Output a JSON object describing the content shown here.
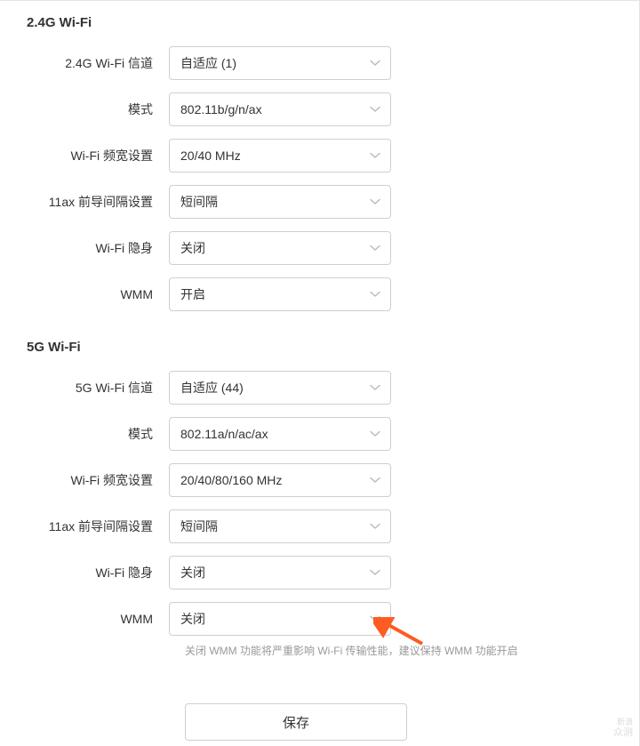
{
  "section24": {
    "title": "2.4G Wi-Fi",
    "channel": {
      "label": "2.4G Wi-Fi 信道",
      "value": "自适应 (1)"
    },
    "mode": {
      "label": "模式",
      "value": "802.11b/g/n/ax"
    },
    "bandwidth": {
      "label": "Wi-Fi 频宽设置",
      "value": "20/40 MHz"
    },
    "guard": {
      "label": "11ax 前导间隔设置",
      "value": "短间隔"
    },
    "hidden": {
      "label": "Wi-Fi 隐身",
      "value": "关闭"
    },
    "wmm": {
      "label": "WMM",
      "value": "开启"
    }
  },
  "section5": {
    "title": "5G Wi-Fi",
    "channel": {
      "label": "5G Wi-Fi 信道",
      "value": "自适应 (44)"
    },
    "mode": {
      "label": "模式",
      "value": "802.11a/n/ac/ax"
    },
    "bandwidth": {
      "label": "Wi-Fi 频宽设置",
      "value": "20/40/80/160 MHz"
    },
    "guard": {
      "label": "11ax 前导间隔设置",
      "value": "短间隔"
    },
    "hidden": {
      "label": "Wi-Fi 隐身",
      "value": "关闭"
    },
    "wmm": {
      "label": "WMM",
      "value": "关闭"
    },
    "wmm_hint": "关闭 WMM 功能将严重影响 Wi-Fi 传输性能，建议保持 WMM 功能开启"
  },
  "actions": {
    "save": "保存"
  },
  "watermark": {
    "line1": "新浪",
    "line2": "众测"
  }
}
